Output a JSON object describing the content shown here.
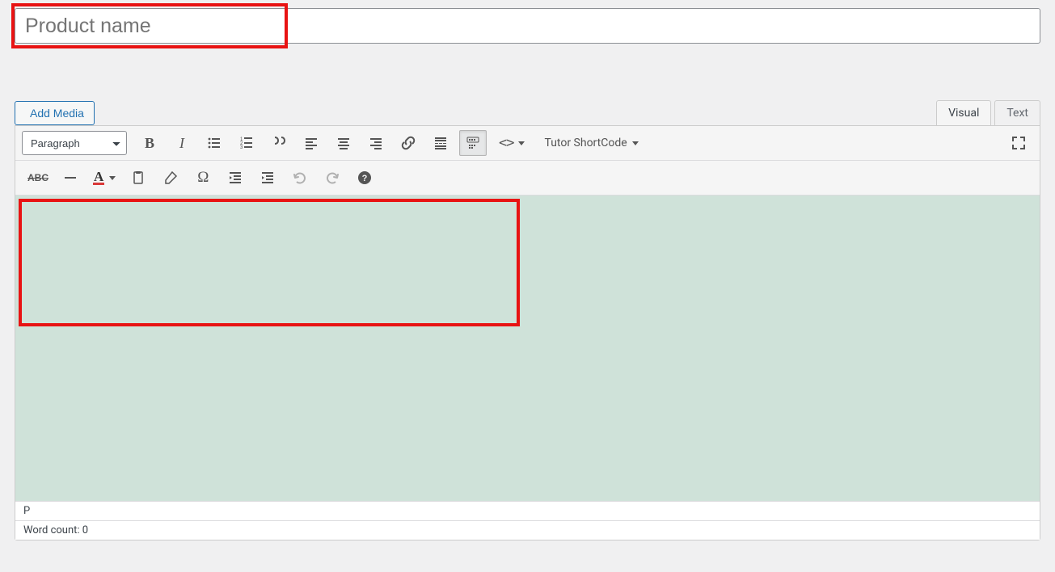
{
  "title": {
    "placeholder": "Product name",
    "value": ""
  },
  "media_button": {
    "label": "Add Media"
  },
  "tabs": {
    "visual": "Visual",
    "text": "Text",
    "active": "visual"
  },
  "format_select": {
    "value": "Paragraph"
  },
  "shortcode_dropdown": {
    "label": "Tutor ShortCode"
  },
  "status": {
    "path": "P",
    "word_count_label": "Word count:",
    "word_count_value": "0"
  }
}
